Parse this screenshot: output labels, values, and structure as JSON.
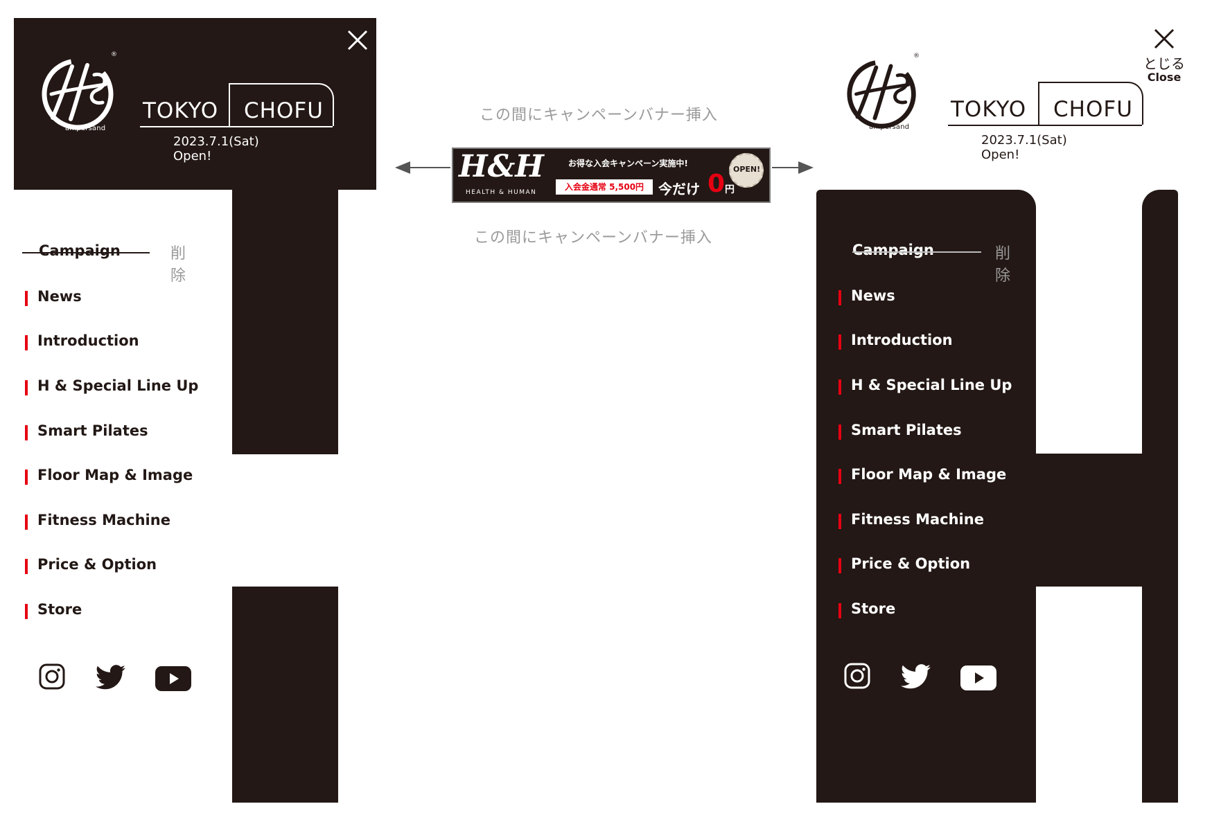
{
  "brand": {
    "logo_sub": "ampersand",
    "registered_mark": "®",
    "location_city": "TOKYO",
    "location_area": "CHOFU",
    "open_date": "2023.7.1(Sat) Open!"
  },
  "close": {
    "ja": "とじる",
    "en": "Close"
  },
  "menu": {
    "campaign": "Campaign",
    "campaign_delete_note": "削除",
    "items": [
      {
        "label": "News"
      },
      {
        "label": "Introduction"
      },
      {
        "label": "H & Special Line Up"
      },
      {
        "label": "Smart Pilates"
      },
      {
        "label": "Floor Map & Image"
      },
      {
        "label": "Fitness Machine"
      },
      {
        "label": "Price & Option"
      },
      {
        "label": "Store"
      }
    ]
  },
  "social": [
    "instagram-icon",
    "twitter-icon",
    "youtube-icon"
  ],
  "center": {
    "insert_note_top": "この間にキャンペーンバナー挿入",
    "insert_note_bottom": "この間にキャンペーンバナー挿入"
  },
  "banner": {
    "logo_text": "H&H",
    "logo_sub": "HEALTH & HUMAN",
    "headline": "お得な入会キャンペーン実施中!",
    "regular_price": "入会金通常 5,500円",
    "now_only": "今だけ",
    "price_zero": "0",
    "price_unit": "円",
    "open_badge": "OPEN!"
  },
  "colors": {
    "dark": "#231815",
    "accent": "#e60012",
    "note_gray": "#9a9a9a",
    "white": "#ffffff"
  }
}
